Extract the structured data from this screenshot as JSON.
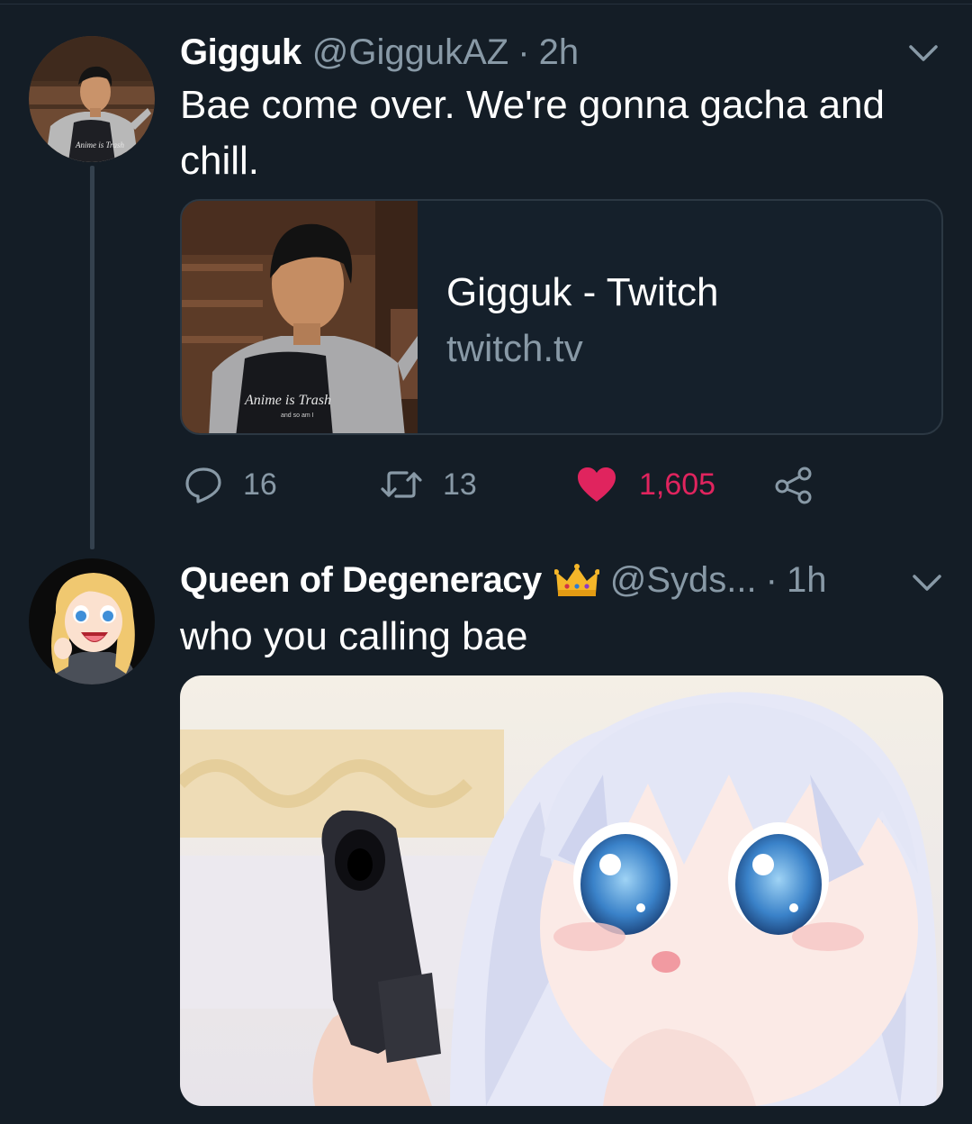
{
  "tweet1": {
    "display_name": "Gigguk",
    "handle": "@GiggukAZ",
    "separator": "·",
    "time": "2h",
    "text": "Bae come over. We're gonna gacha and chill.",
    "avatar_shirt_text": "Anime is Trash",
    "card": {
      "title": "Gigguk - Twitch",
      "domain": "twitch.tv",
      "shirt_text": "Anime is Trash",
      "shirt_subtext": "and so am I"
    },
    "actions": {
      "replies": "16",
      "retweets": "13",
      "likes": "1,605"
    }
  },
  "tweet2": {
    "display_name": "Queen of Degeneracy",
    "handle": "@Syds...",
    "separator": "·",
    "time": "1h",
    "text": "who you calling bae"
  },
  "icons": {
    "reply": "reply-icon",
    "retweet": "retweet-icon",
    "like": "heart-icon",
    "share": "share-icon",
    "more": "chevron-down-icon",
    "crown": "crown-icon"
  },
  "colors": {
    "background": "#141d26",
    "secondary_text": "#8899a6",
    "like": "#e0245e",
    "border": "#2c3843"
  }
}
